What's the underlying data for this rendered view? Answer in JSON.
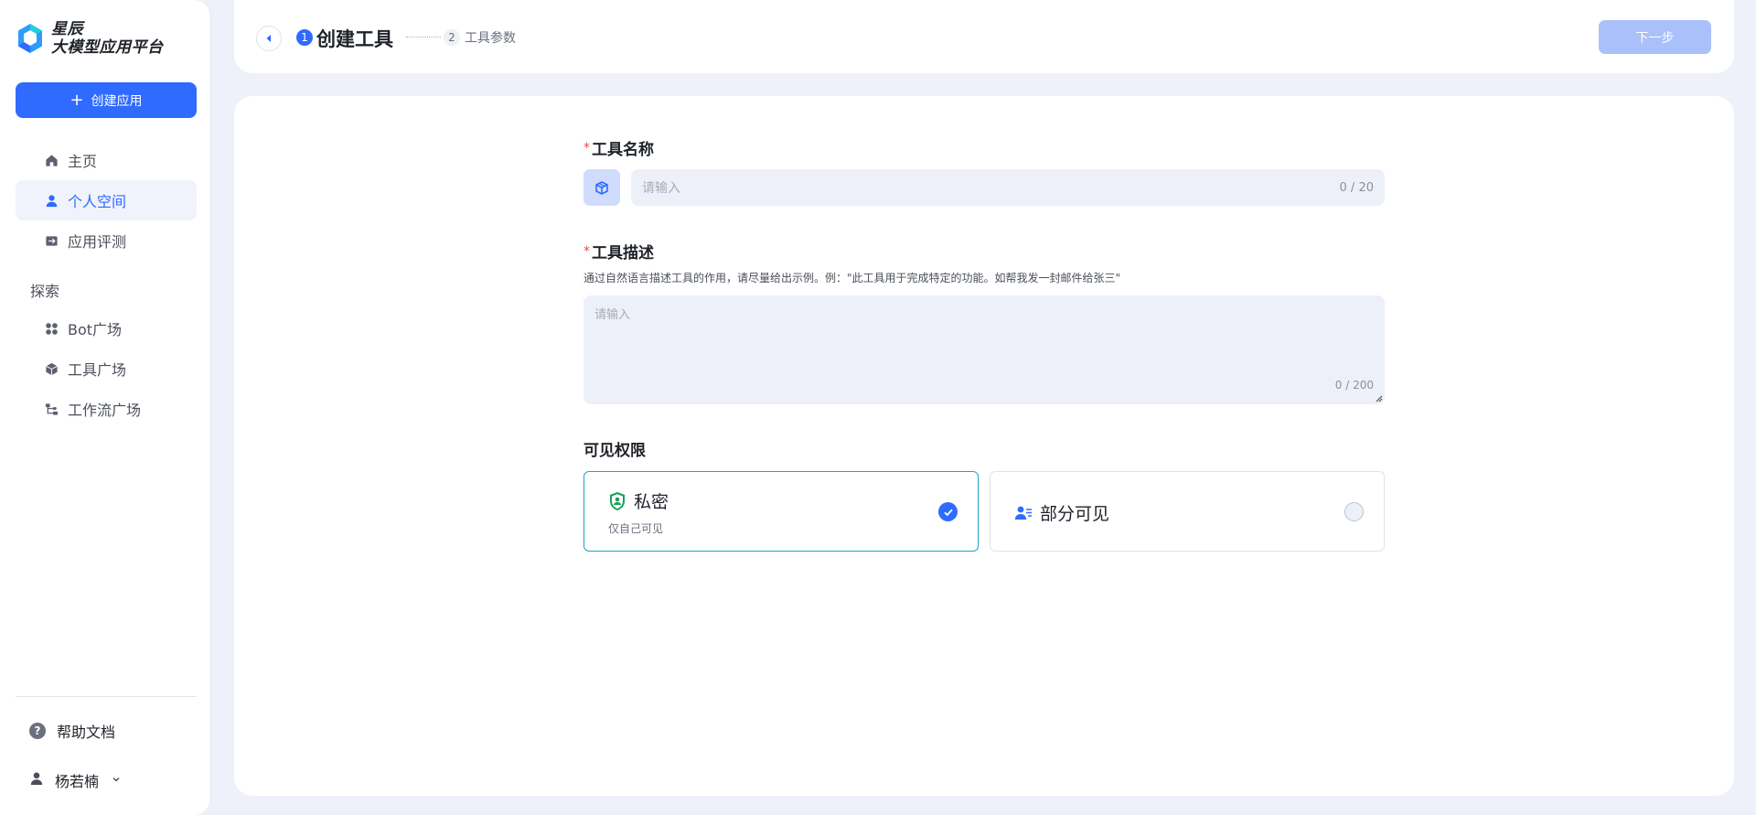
{
  "sidebar": {
    "logo_line1": "星辰",
    "logo_line2": "大模型应用平台",
    "create_label": "创建应用",
    "nav": [
      {
        "label": "主页",
        "icon": "home-icon"
      },
      {
        "label": "个人空间",
        "icon": "user-icon",
        "active": true
      },
      {
        "label": "应用评测",
        "icon": "evaluation-icon"
      }
    ],
    "explore_title": "探索",
    "explore": [
      {
        "label": "Bot广场",
        "icon": "grid-icon"
      },
      {
        "label": "工具广场",
        "icon": "cube-icon"
      },
      {
        "label": "工作流广场",
        "icon": "workflow-icon"
      }
    ],
    "help_label": "帮助文档",
    "user_name": "杨若楠"
  },
  "header": {
    "step1_num": "1",
    "step1_label": "创建工具",
    "step2_num": "2",
    "step2_label": "工具参数",
    "next_label": "下一步"
  },
  "form": {
    "required_mark": "*",
    "name_label": "工具名称",
    "name_placeholder": "请输入",
    "name_counter": "0 / 20",
    "desc_label": "工具描述",
    "desc_hint": "通过自然语言描述工具的作用，请尽量给出示例。例：\"此工具用于完成特定的功能。如帮我发一封邮件给张三\"",
    "desc_placeholder": "请输入",
    "desc_counter": "0 / 200",
    "perm_label": "可见权限",
    "perm_private_title": "私密",
    "perm_private_sub": "仅自己可见",
    "perm_partial_title": "部分可见",
    "selected": "private"
  },
  "colors": {
    "accent": "#2f6bff",
    "disabled_button": "#a9c0fb",
    "selected_border": "#19a7c4",
    "private_icon": "#18a058"
  }
}
